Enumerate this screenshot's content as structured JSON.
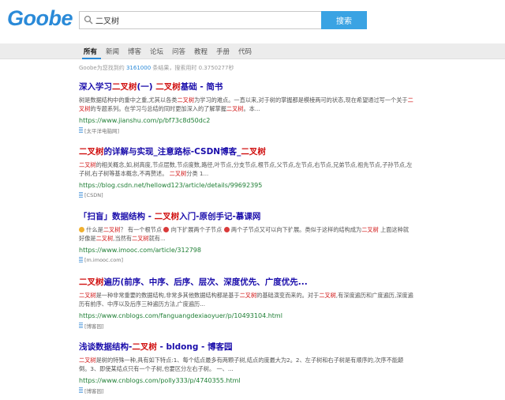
{
  "header": {
    "logo": "Goobe",
    "search_value": "二叉树",
    "search_button": "搜索"
  },
  "tabs": [
    "所有",
    "新闻",
    "博客",
    "论坛",
    "问答",
    "教程",
    "手册",
    "代码"
  ],
  "stats": {
    "prefix": "Goobe为您找到约 ",
    "count": "3161000",
    "suffix": " 条结果，搜索用时 0.3750277秒"
  },
  "results": [
    {
      "title": [
        {
          "t": "深入学习"
        },
        {
          "t": "二叉树",
          "h": true
        },
        {
          "t": "(一) "
        },
        {
          "t": "二叉树",
          "h": true
        },
        {
          "t": "基础 - 简书"
        }
      ],
      "snippet": [
        {
          "t": "树是数据结构中的重中之重,尤其以各类"
        },
        {
          "t": "二叉树",
          "h": true
        },
        {
          "t": "为学习的难点。一直以来,对于树的掌握都是模棱两可的状态,现在希望通过写一个关于"
        },
        {
          "t": "二叉树",
          "h": true
        },
        {
          "t": "的专题系列。在学习与总结的同时更加深入的了解掌握"
        },
        {
          "t": "二叉树",
          "h": true
        },
        {
          "t": "。本..."
        }
      ],
      "url": "https://www.jianshu.com/p/bf73c8d50dc2",
      "source": "[太平洋电脑网]"
    },
    {
      "title": [
        {
          "t": "二叉树",
          "h": true
        },
        {
          "t": "的详解与实现_注意路标-CSDN博客_"
        },
        {
          "t": "二叉树",
          "h": true
        }
      ],
      "snippet": [
        {
          "t": "二叉树",
          "h": true
        },
        {
          "t": "的相关概念,如,树高度,节点层数,节点度数,路径,叶节点,分支节点,根节点,父节点,左节点,右节点,兄弟节点,祖先节点,子孙节点,左子树,右子树等基本概念,不再赘述。 "
        },
        {
          "t": "二叉树",
          "h": true
        },
        {
          "t": "分类 1..."
        }
      ],
      "url": "https://blog.csdn.net/hellowd123/article/details/99692395",
      "source": "[CSDN]"
    },
    {
      "title": [
        {
          "t": "「扫盲」数据结构 - "
        },
        {
          "t": "二叉树",
          "h": true
        },
        {
          "t": "入门-原创手记-慕课网"
        }
      ],
      "snippet": [
        {
          "d": "face"
        },
        {
          "t": " 什么是"
        },
        {
          "t": "二叉树",
          "h": true
        },
        {
          "t": "？ 有一个根节点 "
        },
        {
          "d": "red"
        },
        {
          "t": " 向下扩展两个子节点 "
        },
        {
          "d": "red"
        },
        {
          "t": " 两个子节点又可以向下扩展。类似于这样的结构成为"
        },
        {
          "t": "二叉树",
          "h": true
        },
        {
          "t": " 上面这种就好像是"
        },
        {
          "t": "二叉树",
          "h": true
        },
        {
          "t": ",当然有"
        },
        {
          "t": "二叉树",
          "h": true
        },
        {
          "t": "就有..."
        }
      ],
      "url": "https://www.imooc.com/article/312798",
      "source": "[m.imooc.com]"
    },
    {
      "title": [
        {
          "t": "二叉树",
          "h": true
        },
        {
          "t": "遍历(前序、中序、后序、层次、深度优先、广度优先..."
        }
      ],
      "snippet": [
        {
          "t": "二叉树",
          "h": true
        },
        {
          "t": "是一种非常重要的数据结构,非常多其他数据结构都是基于"
        },
        {
          "t": "二叉树",
          "h": true
        },
        {
          "t": "的基础演变而来的。对于"
        },
        {
          "t": "二叉树",
          "h": true
        },
        {
          "t": ",有深度遍历和广度遍历,深度遍历有前序、中序以及后序三种遍历方法,广度遍历..."
        }
      ],
      "url": "https://www.cnblogs.com/fanguangdexiaoyuer/p/10493104.html",
      "source": "[博客园]"
    },
    {
      "title": [
        {
          "t": "浅谈数据结构-"
        },
        {
          "t": "二叉树",
          "h": true
        },
        {
          "t": " - bldong - 博客园"
        }
      ],
      "snippet": [
        {
          "t": "二叉树",
          "h": true
        },
        {
          "t": "是树的特殊一种,具有如下特点:1、每个结点最多有两颗子树,结点的度最大为2。2、左子树和右子树是有顺序的,次序不能颠倒。3、即使某结点只有一个子树,也要区分左右子树。 一、..."
        }
      ],
      "url": "https://www.cnblogs.com/polly333/p/4740355.html",
      "source": "[博客园]"
    }
  ]
}
